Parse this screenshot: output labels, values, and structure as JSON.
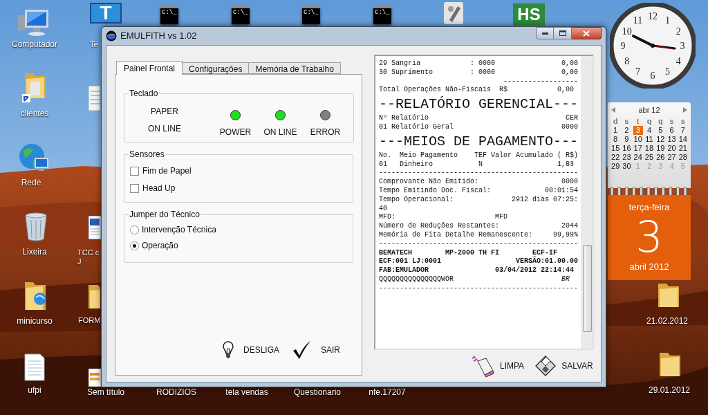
{
  "desktop_icons": [
    {
      "label": "Computador",
      "kind": "computer"
    },
    {
      "label": "clientes",
      "kind": "folder-link"
    },
    {
      "label": "Rede",
      "kind": "network"
    },
    {
      "label": "Lixeira",
      "kind": "trash"
    },
    {
      "label": "minicurso",
      "kind": "folder-globe"
    },
    {
      "label": "ufpi",
      "kind": "text-file"
    },
    {
      "label": "Te",
      "kind": "app-t",
      "icon_text": "T"
    },
    {
      "kind": "notepad"
    },
    {
      "label": "TCC c\nJ",
      "kind": "word-doc"
    },
    {
      "label": "FORM",
      "kind": "folder"
    },
    {
      "label": "Sem título",
      "kind": "orange-doc"
    },
    {
      "label": "RODIZIOS"
    },
    {
      "label": "tela vendas"
    },
    {
      "label": "Questionario"
    },
    {
      "label": "nfe.17207"
    },
    {
      "kind": "console",
      "icon_text": "C:\\_"
    },
    {
      "kind": "console",
      "icon_text": "C:\\_"
    },
    {
      "kind": "console",
      "icon_text": "C:\\_"
    },
    {
      "kind": "console",
      "icon_text": "C:\\_"
    },
    {
      "kind": "tool"
    },
    {
      "kind": "app-hs",
      "icon_text": "HS"
    },
    {
      "label": "21.02.2012",
      "kind": "folder"
    },
    {
      "label": "29.01.2012",
      "kind": "folder"
    }
  ],
  "clock": {
    "numerals": [
      "12",
      "1",
      "2",
      "3",
      "4",
      "5",
      "6",
      "7",
      "8",
      "9",
      "10",
      "11"
    ]
  },
  "calendar": {
    "month": "abr 12",
    "weekdays": [
      {
        "label": "d",
        "selected": false
      },
      {
        "label": "s",
        "selected": false
      },
      {
        "label": "t",
        "selected": true
      },
      {
        "label": "q",
        "selected": false
      },
      {
        "label": "q",
        "selected": false
      },
      {
        "label": "s",
        "selected": false
      },
      {
        "label": "s",
        "selected": false
      }
    ],
    "days": [
      {
        "label": "1",
        "selected": false,
        "other_month": false
      },
      {
        "label": "2",
        "selected": false,
        "other_month": false
      },
      {
        "label": "3",
        "selected": true,
        "other_month": false
      },
      {
        "label": "4",
        "selected": false,
        "other_month": false
      },
      {
        "label": "5",
        "selected": false,
        "other_month": false
      },
      {
        "label": "6",
        "selected": false,
        "other_month": false
      },
      {
        "label": "7",
        "selected": false,
        "other_month": false
      },
      {
        "label": "8",
        "selected": false,
        "other_month": false
      },
      {
        "label": "9",
        "selected": false,
        "other_month": false
      },
      {
        "label": "10",
        "selected": false,
        "other_month": false
      },
      {
        "label": "11",
        "selected": false,
        "other_month": false
      },
      {
        "label": "12",
        "selected": false,
        "other_month": false
      },
      {
        "label": "13",
        "selected": false,
        "other_month": false
      },
      {
        "label": "14",
        "selected": false,
        "other_month": false
      },
      {
        "label": "15",
        "selected": false,
        "other_month": false
      },
      {
        "label": "16",
        "selected": false,
        "other_month": false
      },
      {
        "label": "17",
        "selected": false,
        "other_month": false
      },
      {
        "label": "18",
        "selected": false,
        "other_month": false
      },
      {
        "label": "19",
        "selected": false,
        "other_month": false
      },
      {
        "label": "20",
        "selected": false,
        "other_month": false
      },
      {
        "label": "21",
        "selected": false,
        "other_month": false
      },
      {
        "label": "22",
        "selected": false,
        "other_month": false
      },
      {
        "label": "23",
        "selected": false,
        "other_month": false
      },
      {
        "label": "24",
        "selected": false,
        "other_month": false
      },
      {
        "label": "25",
        "selected": false,
        "other_month": false
      },
      {
        "label": "26",
        "selected": false,
        "other_month": false
      },
      {
        "label": "27",
        "selected": false,
        "other_month": false
      },
      {
        "label": "28",
        "selected": false,
        "other_month": false
      },
      {
        "label": "29",
        "selected": false,
        "other_month": false
      },
      {
        "label": "30",
        "selected": false,
        "other_month": false
      },
      {
        "label": "1",
        "selected": false,
        "other_month": true
      },
      {
        "label": "2",
        "selected": false,
        "other_month": true
      },
      {
        "label": "3",
        "selected": false,
        "other_month": true
      },
      {
        "label": "4",
        "selected": false,
        "other_month": true
      },
      {
        "label": "5",
        "selected": false,
        "other_month": true
      }
    ],
    "weekday_name": "terça-feira",
    "day": "3",
    "month_year": "abril 2012"
  },
  "window": {
    "title": "EMULFITH vs 1.02",
    "tabs": [
      {
        "label": "Painel Frontal",
        "selected": true
      },
      {
        "label": "Configurações",
        "selected": false
      },
      {
        "label": "Memória de Trabalho",
        "selected": false
      }
    ],
    "teclado": {
      "title": "Teclado",
      "keys": [
        "PAPER",
        "ON LINE"
      ],
      "leds": [
        {
          "label": "POWER",
          "on": true
        },
        {
          "label": "ON LINE",
          "on": true
        },
        {
          "label": "ERROR",
          "on": false
        }
      ]
    },
    "sensores": {
      "title": "Sensores",
      "checkboxes": [
        {
          "label": "Fim de Papel",
          "checked": false
        },
        {
          "label": "Head Up",
          "checked": false
        }
      ]
    },
    "jumper": {
      "title": "Jumper do Técnico",
      "radios": [
        {
          "label": "Intervenção Técnica",
          "selected": false
        },
        {
          "label": "Operação",
          "selected": true
        }
      ]
    },
    "bottom_buttons": [
      {
        "label": "DESLIGA",
        "kind": "bulb"
      },
      {
        "label": "SAIR",
        "kind": "check"
      }
    ],
    "receipt": [
      {
        "text": "29 Sangria            : 0000                0,00",
        "kind": "normal"
      },
      {
        "text": "30 Suprimento         : 0000                0,00",
        "kind": "normal"
      },
      {
        "text": "                              ------------------",
        "kind": "normal"
      },
      {
        "text": "Total Operações Não-Fiscais  R$            0,00",
        "kind": "normal"
      },
      {
        "text": "--RELATÓRIO GERENCIAL---",
        "kind": "big"
      },
      {
        "text": "Nº Relatório                                 CER",
        "kind": "normal"
      },
      {
        "text": "01 Relatório Geral                          0000",
        "kind": "normal"
      },
      {
        "text": "---MEIOS DE PAGAMENTO---",
        "kind": "big"
      },
      {
        "text": "No.  Meio Pagamento    TEF Valor Acumulado ( R$)",
        "kind": "normal"
      },
      {
        "text": "01   Dinheiro           N                  1,83",
        "kind": "normal"
      },
      {
        "text": "------------------------------------------------",
        "kind": "normal"
      },
      {
        "text": "Comprovante Não Emitido:                    0000",
        "kind": "normal"
      },
      {
        "text": "Tempo Emitindo Doc. Fiscal:             00:01:54",
        "kind": "normal"
      },
      {
        "text": "Tempo Operacional:              2912 dias 07:25:",
        "kind": "normal"
      },
      {
        "text": "40",
        "kind": "normal"
      },
      {
        "text": "MFD:                        MFD",
        "kind": "normal"
      },
      {
        "text": "Número de Reduções Restantes:               2044",
        "kind": "normal"
      },
      {
        "text": "Memória de Fita Detalhe Remanescente:     99,99%",
        "kind": "normal"
      },
      {
        "text": "------------------------------------------------",
        "kind": "normal"
      },
      {
        "text": "BEMATECH        MP-2000 TH FI        ECF-IF",
        "kind": "bold"
      },
      {
        "text": "ECF:001 LJ:0001                  VERSÃO:01.00.00",
        "kind": "bold"
      },
      {
        "text": "FAB:EMULADOR                03/04/2012 22:14:44",
        "kind": "bold"
      },
      {
        "text": "QQQQQQQQQQQQQQQWOR                          *BR*",
        "kind": "normal"
      },
      {
        "text": "------------------------------------------------",
        "kind": "normal"
      }
    ],
    "side_buttons": [
      {
        "label": "LIMPA",
        "kind": "eraser"
      },
      {
        "label": "SALVAR",
        "kind": "disk"
      }
    ]
  }
}
